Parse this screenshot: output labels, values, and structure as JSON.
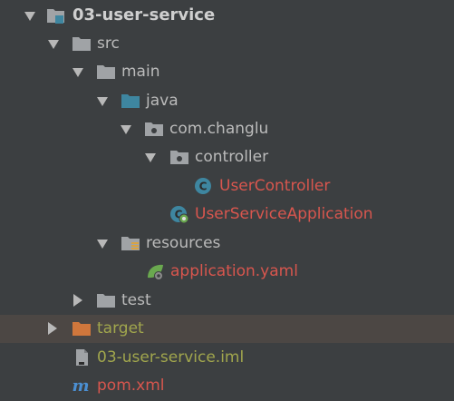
{
  "tree": {
    "root": {
      "label": "03-user-service",
      "icon": "module-folder-icon"
    },
    "src": {
      "label": "src",
      "icon": "folder-icon"
    },
    "main": {
      "label": "main",
      "icon": "folder-icon"
    },
    "java": {
      "label": "java",
      "icon": "source-root-folder-icon"
    },
    "pkg": {
      "label": "com.changlu",
      "icon": "package-icon"
    },
    "controller": {
      "label": "controller",
      "icon": "package-icon"
    },
    "user_controller": {
      "label": "UserController",
      "icon": "java-class-icon"
    },
    "app": {
      "label": "UserServiceApplication",
      "icon": "spring-boot-app-icon"
    },
    "resources": {
      "label": "resources",
      "icon": "resources-folder-icon"
    },
    "yaml": {
      "label": "application.yaml",
      "icon": "spring-config-icon"
    },
    "test": {
      "label": "test",
      "icon": "folder-icon"
    },
    "target": {
      "label": "target",
      "icon": "excluded-folder-icon"
    },
    "iml": {
      "label": "03-user-service.iml",
      "icon": "iml-file-icon"
    },
    "pom": {
      "label": "pom.xml",
      "icon": "maven-icon"
    }
  },
  "colors": {
    "background": "#3c3f41",
    "highlight_row": "#4c4744",
    "text": "#bbbbbb",
    "modified_red": "#d8564e",
    "excluded_yellow": "#a1a64d",
    "folder_grey": "#a0a3a6",
    "source_blue": "#3e86a0",
    "target_orange": "#d0773c",
    "maven_blue": "#4b8fd2",
    "spring_green": "#6aa84f"
  }
}
